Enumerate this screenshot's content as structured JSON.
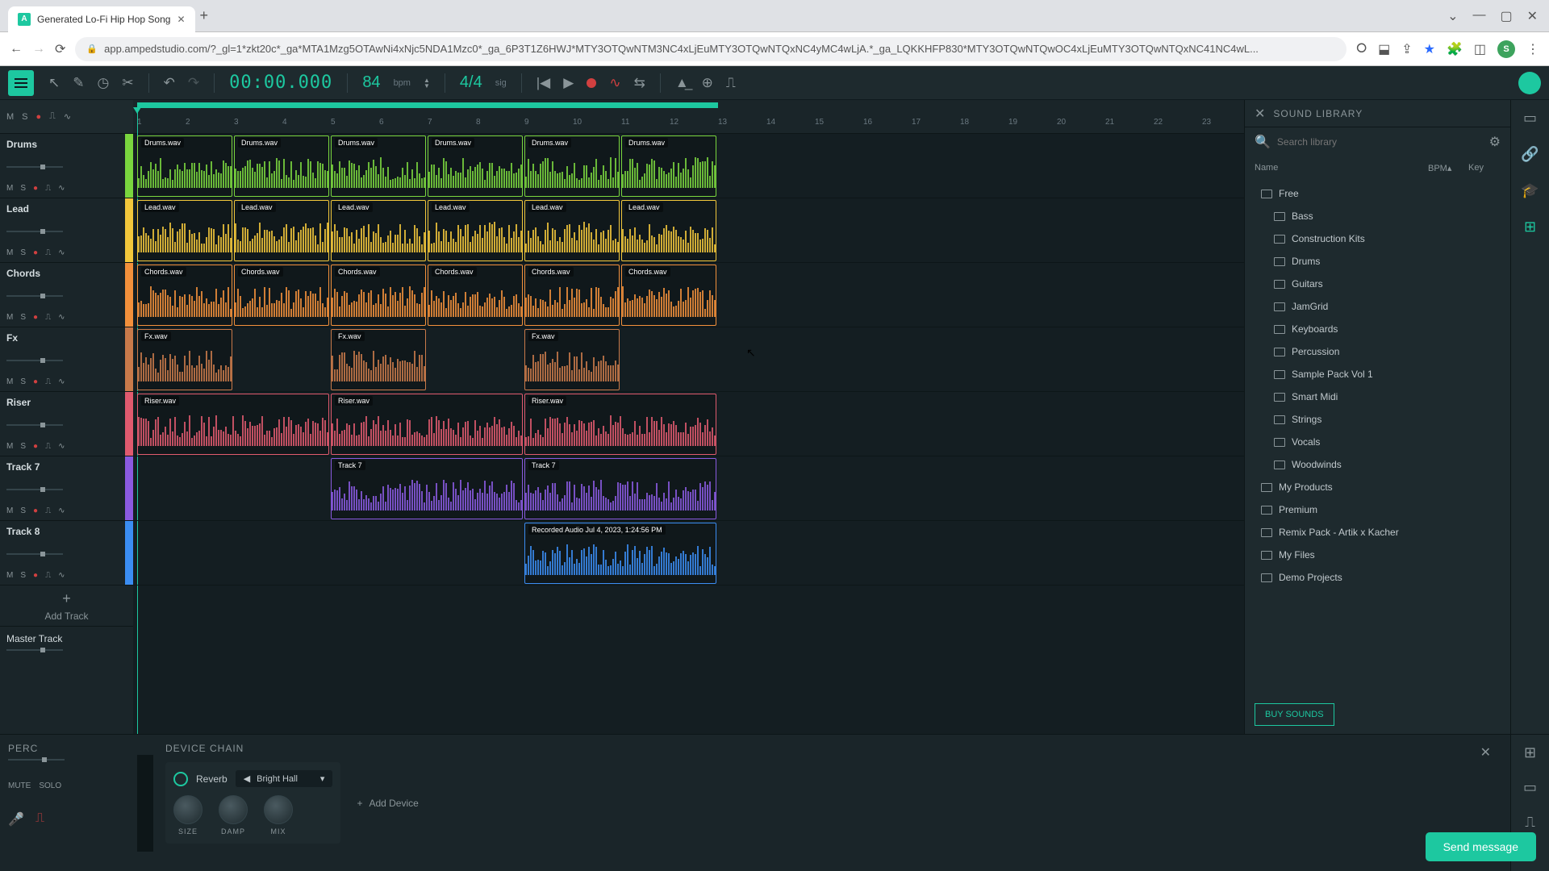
{
  "browser": {
    "tab_title": "Generated Lo-Fi Hip Hop Song",
    "url": "app.ampedstudio.com/?_gl=1*zkt20c*_ga*MTA1Mzg5OTAwNi4xNjc5NDA1Mzc0*_ga_6P3T1Z6HWJ*MTY3OTQwNTM3NC4xLjEuMTY3OTQwNTQxNC4yMC4wLjA.*_ga_LQKKHFP830*MTY3OTQwNTQwOC4xLjEuMTY3OTQwNTQxNC41NC4wL...",
    "avatar_letter": "S"
  },
  "transport": {
    "time": "00:00.000",
    "bpm": "84",
    "bpm_label": "bpm",
    "sig": "4/4",
    "sig_label": "sig"
  },
  "ruler_marks": [
    "1",
    "2",
    "3",
    "4",
    "5",
    "6",
    "7",
    "8",
    "9",
    "10",
    "11",
    "12",
    "13",
    "14",
    "15",
    "16",
    "17",
    "18",
    "19",
    "20",
    "21",
    "22",
    "23"
  ],
  "loop_end_beats": 12,
  "tracks": [
    {
      "name": "Drums",
      "color": "#7ad63e",
      "clip": "Drums.wav",
      "clips_at": [
        0,
        2,
        4,
        6,
        8,
        10
      ],
      "clip_len": 2
    },
    {
      "name": "Lead",
      "color": "#f2c73b",
      "clip": "Lead.wav",
      "clips_at": [
        0,
        2,
        4,
        6,
        8,
        10
      ],
      "clip_len": 2
    },
    {
      "name": "Chords",
      "color": "#f2903b",
      "clip": "Chords.wav",
      "clips_at": [
        0,
        2,
        4,
        6,
        8,
        10
      ],
      "clip_len": 2
    },
    {
      "name": "Fx",
      "color": "#c97a4a",
      "clip": "Fx.wav",
      "clips_at": [
        0,
        4,
        8
      ],
      "clip_len": 2
    },
    {
      "name": "Riser",
      "color": "#e05a6e",
      "clip": "Riser.wav",
      "clips_at": [
        0,
        4,
        8
      ],
      "clip_len": 4
    },
    {
      "name": "Track 7",
      "color": "#8a5ae0",
      "clip": "Track 7",
      "clips_at": [
        4,
        8
      ],
      "clip_len": 4
    },
    {
      "name": "Track 8",
      "color": "#3b8df2",
      "clip": "Recorded Audio Jul 4, 2023, 1:24:56 PM",
      "clips_at": [
        8
      ],
      "clip_len": 4
    }
  ],
  "track_btns": {
    "mute": "M",
    "solo": "S",
    "add": "+",
    "add_label": "Add Track",
    "master": "Master Track"
  },
  "library": {
    "title": "SOUND LIBRARY",
    "search_placeholder": "Search library",
    "cols": {
      "name": "Name",
      "bpm": "BPM▴",
      "key": "Key"
    },
    "tree": [
      {
        "label": "Free",
        "level": 0
      },
      {
        "label": "Bass",
        "level": 1
      },
      {
        "label": "Construction Kits",
        "level": 1
      },
      {
        "label": "Drums",
        "level": 1
      },
      {
        "label": "Guitars",
        "level": 1
      },
      {
        "label": "JamGrid",
        "level": 1
      },
      {
        "label": "Keyboards",
        "level": 1
      },
      {
        "label": "Percussion",
        "level": 1
      },
      {
        "label": "Sample Pack Vol 1",
        "level": 1
      },
      {
        "label": "Smart Midi",
        "level": 1
      },
      {
        "label": "Strings",
        "level": 1
      },
      {
        "label": "Vocals",
        "level": 1
      },
      {
        "label": "Woodwinds",
        "level": 1
      },
      {
        "label": "My Products",
        "level": 0
      },
      {
        "label": "Premium",
        "level": 0
      },
      {
        "label": "Remix Pack - Artik x Kacher",
        "level": 0
      },
      {
        "label": "My Files",
        "level": 0
      },
      {
        "label": "Demo Projects",
        "level": 0
      }
    ],
    "buy": "BUY SOUNDS"
  },
  "bottom": {
    "perc": "PERC",
    "mute": "MUTE",
    "solo": "SOLO",
    "device_chain": "DEVICE CHAIN",
    "device_name": "Reverb",
    "preset": "Bright Hall",
    "knobs": [
      "SIZE",
      "DAMP",
      "MIX"
    ],
    "add_device": "Add Device"
  },
  "send_message": "Send message"
}
